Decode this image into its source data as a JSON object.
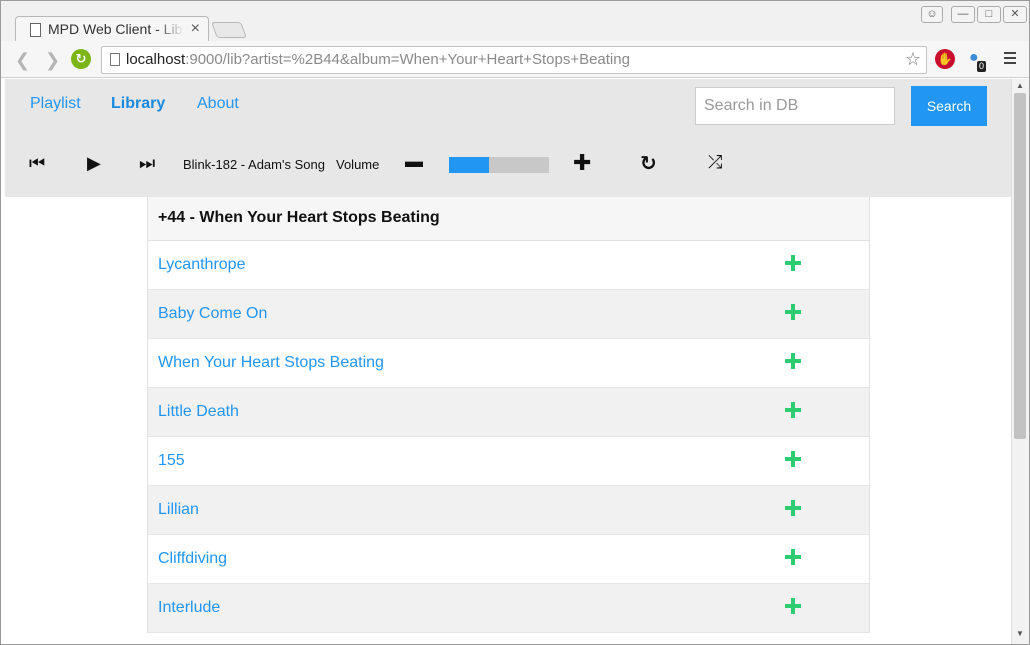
{
  "browser": {
    "tab_title": "MPD Web Client - Library",
    "tab_close": "×",
    "url_host": "localhost",
    "url_rest": ":9000/lib?artist=%2B44&album=When+Your+Heart+Stops+Beating",
    "extension_badge": "0",
    "icons": [
      "page-icon",
      "close-icon",
      "back-icon",
      "forward-icon",
      "reload-icon",
      "star-icon",
      "stop-icon",
      "ghost-icon",
      "menu-icon",
      "user-icon",
      "minimize-icon",
      "maximize-icon"
    ]
  },
  "nav": {
    "playlist": "Playlist",
    "library": "Library",
    "about": "About"
  },
  "search": {
    "placeholder": "Search in DB",
    "button": "Search"
  },
  "player": {
    "now_playing": "Blink-182 - Adam's Song",
    "volume_label": "Volume",
    "volume_level": 0.4,
    "accent_color": "#2196f3",
    "add_color": "#2ecc71"
  },
  "album": {
    "title": "+44 - When Your Heart Stops Beating",
    "tracks": [
      "Lycanthrope",
      "Baby Come On",
      "When Your Heart Stops Beating",
      "Little Death",
      "155",
      "Lillian",
      "Cliffdiving",
      "Interlude"
    ]
  }
}
